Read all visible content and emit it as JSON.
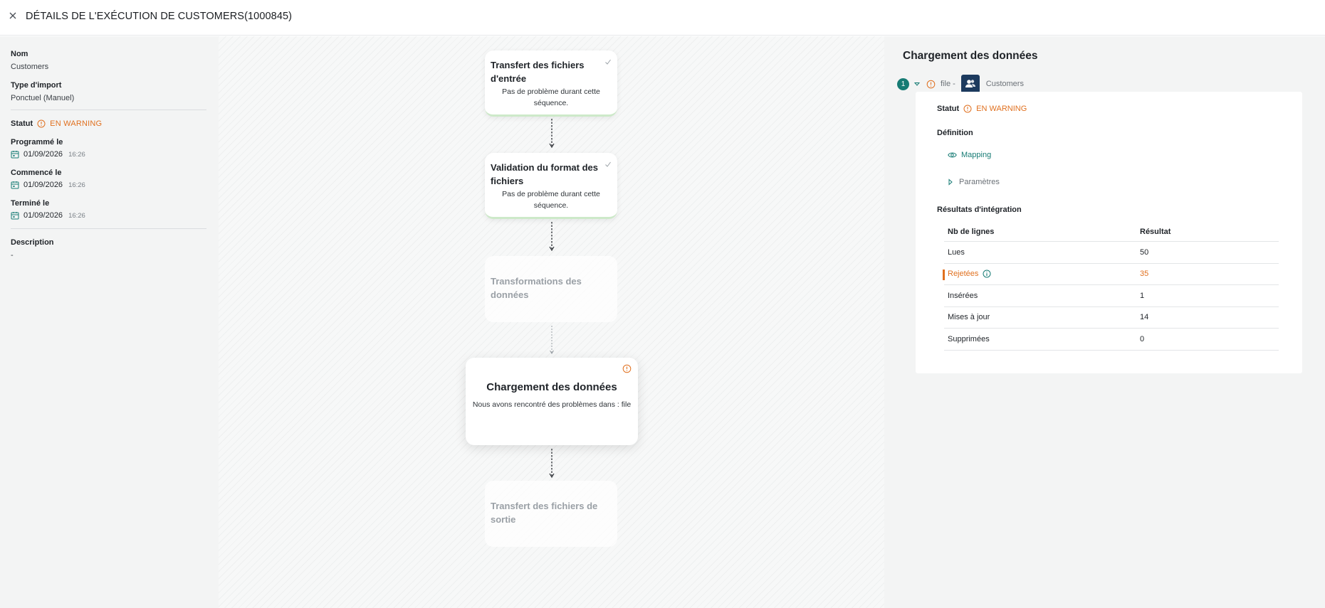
{
  "header": {
    "title": "DÉTAILS DE L'EXÉCUTION DE CUSTOMERS(1000845)"
  },
  "sidebar": {
    "name_label": "Nom",
    "name_value": "Customers",
    "import_type_label": "Type d'import",
    "import_type_value": "Ponctuel (Manuel)",
    "status_label": "Statut",
    "status_value": "EN WARNING",
    "scheduled_label": "Programmé le",
    "scheduled_date": "01/09/2026",
    "scheduled_time": "16:26",
    "started_label": "Commencé le",
    "started_date": "01/09/2026",
    "started_time": "16:26",
    "ended_label": "Terminé le",
    "ended_date": "01/09/2026",
    "ended_time": "16:26",
    "description_label": "Description",
    "description_value": "-"
  },
  "pipeline": {
    "steps": [
      {
        "title": "Transfert des fichiers d'entrée",
        "desc": "Pas de problème durant cette séquence.",
        "state": "done"
      },
      {
        "title": "Validation du format des fichiers",
        "desc": "Pas de problème durant cette séquence.",
        "state": "done"
      },
      {
        "title": "Transformations des données",
        "desc": "",
        "state": "skipped"
      },
      {
        "title": "Chargement des données",
        "desc": "Nous avons rencontré des problèmes dans : file",
        "state": "warning"
      },
      {
        "title": "Transfert des fichiers de sortie",
        "desc": "",
        "state": "pending"
      }
    ]
  },
  "details": {
    "title": "Chargement des données",
    "step_number": "1",
    "file_label": "file -",
    "customer_label": "Customers",
    "status_label": "Statut",
    "status_value": "EN WARNING",
    "definition_label": "Définition",
    "mapping_link": "Mapping",
    "params_label": "Paramètres",
    "results_label": "Résultats d'intégration",
    "table": {
      "headers": [
        "Nb de lignes",
        "Résultat"
      ],
      "rows": [
        {
          "label": "Lues",
          "value": "50"
        },
        {
          "label": "Rejetées",
          "value": "35"
        },
        {
          "label": "Insérées",
          "value": "1"
        },
        {
          "label": "Mises à jour",
          "value": "14"
        },
        {
          "label": "Supprimées",
          "value": "0"
        }
      ]
    }
  },
  "colors": {
    "warning": "#e0701f",
    "teal": "#167b74",
    "success_border": "#cde9c9",
    "avatar_bg": "#1c3a5e"
  }
}
